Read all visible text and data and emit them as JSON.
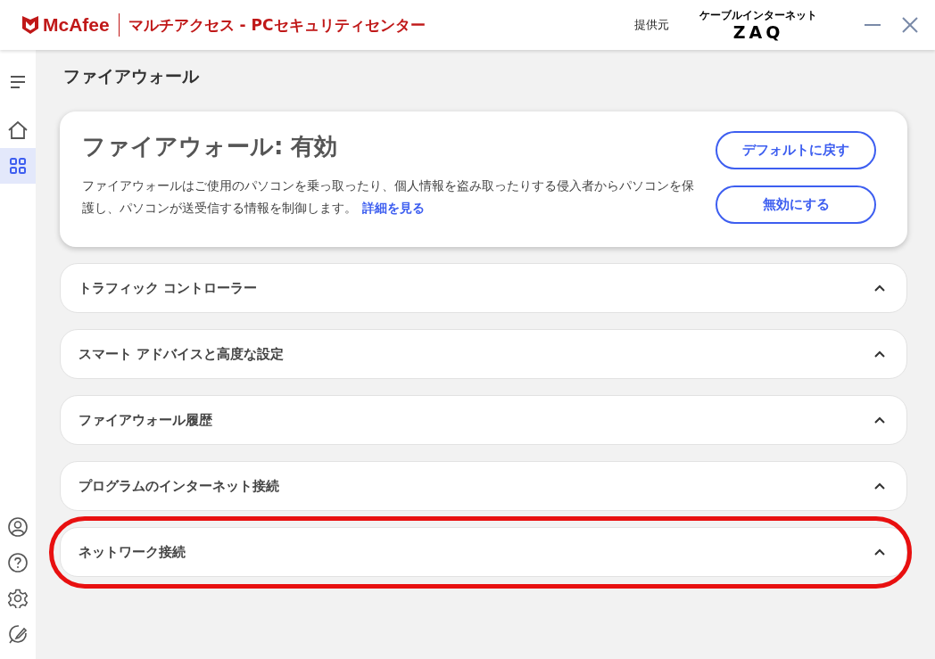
{
  "window": {
    "brand": "McAfee",
    "title": "マルチアクセス - PCセキュリティセンター",
    "provider_label": "提供元",
    "provider_tagline": "ケーブルインターネット",
    "provider_logo": "ZAQ"
  },
  "sidebar": {
    "top_items": [
      {
        "kind": "home",
        "selected": false
      },
      {
        "kind": "apps",
        "selected": true
      }
    ],
    "bottom_items": [
      {
        "kind": "account"
      },
      {
        "kind": "help"
      },
      {
        "kind": "settings"
      },
      {
        "kind": "feedback"
      }
    ]
  },
  "page_title": "ファイアウォール",
  "status_card": {
    "title": "ファイアウォール: 有効",
    "description": "ファイアウォールはご使用のパソコンを乗っ取ったり、個人情報を盗み取ったりする侵入者からパソコンを保護し、パソコンが送受信する情報を制御します。",
    "link": "詳細を見る",
    "buttons": [
      "デフォルトに戻す",
      "無効にする"
    ]
  },
  "sections": [
    {
      "label": "トラフィック コントローラー",
      "highlighted": false
    },
    {
      "label": "スマート アドバイスと高度な設定",
      "highlighted": false
    },
    {
      "label": "ファイアウォール履歴",
      "highlighted": false
    },
    {
      "label": "プログラムのインターネット接続",
      "highlighted": false
    },
    {
      "label": "ネットワーク接続",
      "highlighted": true
    }
  ]
}
